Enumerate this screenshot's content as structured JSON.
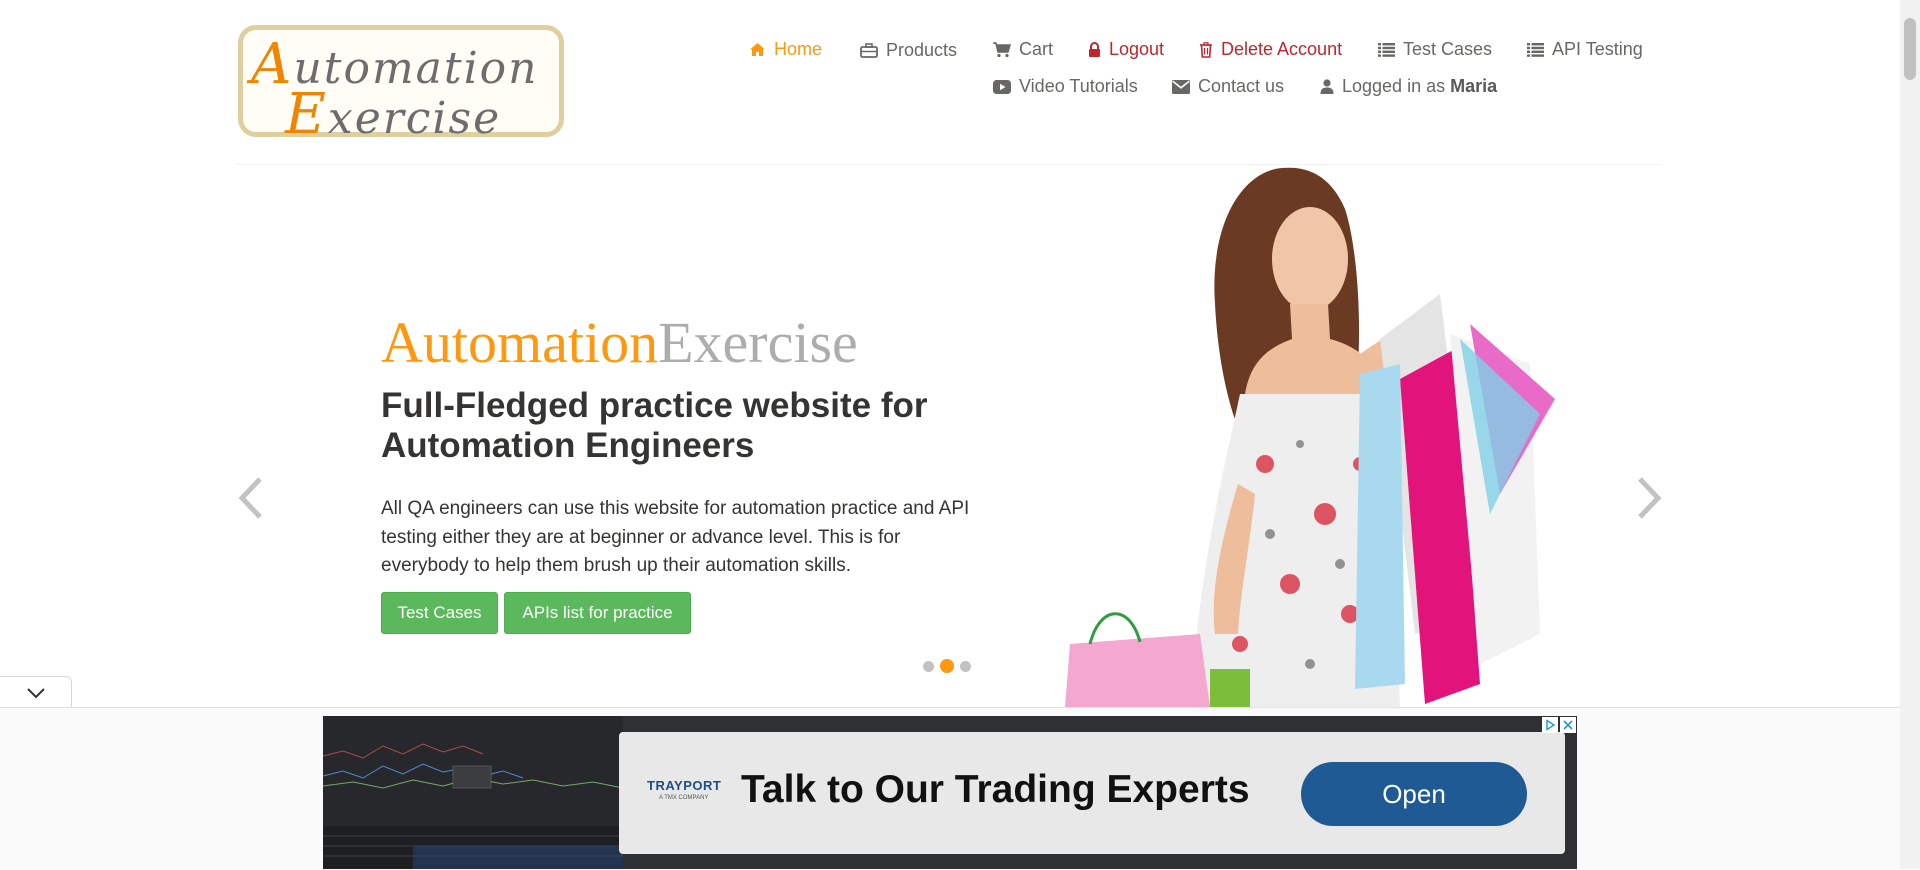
{
  "header": {
    "logo": {
      "line1": "Automation",
      "line2": "Exercise"
    },
    "nav": {
      "home": "Home",
      "products": "Products",
      "cart": "Cart",
      "logout": "Logout",
      "delete_account": "Delete Account",
      "test_cases": "Test Cases",
      "api_testing": "API Testing",
      "video_tutorials": "Video Tutorials",
      "contact_us": "Contact us",
      "logged_in_prefix": "Logged in as",
      "logged_in_user": "Maria"
    }
  },
  "slider": {
    "brand_part1": "Automation",
    "brand_part2": "Exercise",
    "headline": "Full-Fledged practice website for Automation Engineers",
    "description": "All QA engineers can use this website for automation practice and API testing either they are at beginner or advance level. This is for everybody to help them brush up their automation skills.",
    "buttons": {
      "test_cases": "Test Cases",
      "apis_list": "APIs list for practice"
    },
    "indicators": {
      "count": 3,
      "active_index": 1
    }
  },
  "ad": {
    "brand": "TRAYPORT",
    "brand_sub": "A TMX COMPANY",
    "headline": "Talk to Our Trading Experts",
    "cta": "Open"
  },
  "colors": {
    "accent": "#fe980f",
    "danger": "#c0252b",
    "success_button": "#5cb85c",
    "ad_cta": "#1f5a94"
  }
}
